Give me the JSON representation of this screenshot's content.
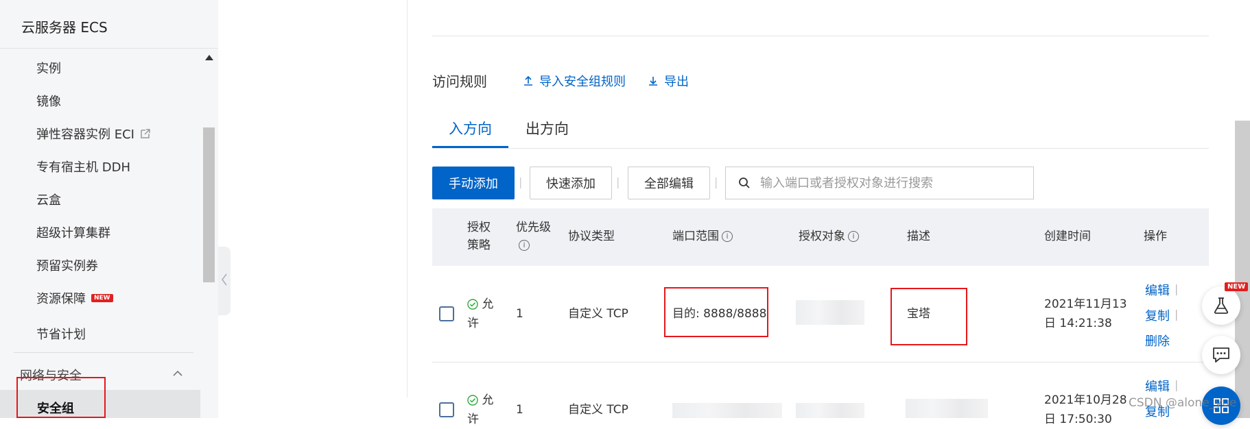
{
  "sidebar": {
    "title": "云服务器 ECS",
    "items": [
      {
        "label": "实例"
      },
      {
        "label": "镜像"
      },
      {
        "label": "弹性容器实例 ECI"
      },
      {
        "label": "专有宿主机 DDH"
      },
      {
        "label": "云盒"
      },
      {
        "label": "超级计算集群"
      },
      {
        "label": "预留实例券"
      },
      {
        "label": "资源保障",
        "badge": "NEW"
      },
      {
        "label": "节省计划"
      }
    ],
    "section": "网络与安全",
    "active_item": "安全组"
  },
  "rules": {
    "title": "访问规则",
    "import_label": "导入安全组规则",
    "export_label": "导出"
  },
  "tabs": {
    "inbound": "入方向",
    "outbound": "出方向"
  },
  "toolbar": {
    "manual_add": "手动添加",
    "quick_add": "快速添加",
    "edit_all": "全部编辑",
    "separator": "|",
    "search_placeholder": "输入端口或者授权对象进行搜索"
  },
  "table": {
    "columns": {
      "policy_line1": "授权",
      "policy_line2": "策略",
      "priority": "优先级",
      "protocol": "协议类型",
      "port_range": "端口范围",
      "auth_object": "授权对象",
      "description": "描述",
      "created": "创建时间",
      "actions": "操作"
    },
    "rows": [
      {
        "policy_line1": "允",
        "policy_line2": "许",
        "priority": "1",
        "protocol": "自定义 TCP",
        "port_range": "目的: 8888/8888",
        "description": "宝塔",
        "created_line1": "2021年11月13",
        "created_line2": "日 14:21:38",
        "actions": [
          "编辑",
          "复制",
          "删除"
        ]
      },
      {
        "policy_line1": "允",
        "policy_line2": "许",
        "priority": "1",
        "protocol": "自定义 TCP",
        "created_line1": "2021年10月28",
        "created_line2": "日 17:50:30",
        "actions": [
          "编辑",
          "复制"
        ]
      }
    ]
  },
  "float_tools": {
    "beta_badge": "NEW"
  },
  "watermark": "CSDN @alone_yue",
  "colors": {
    "accent": "#0064c8",
    "highlight_red": "#e6161a",
    "success_green": "#2fa83a"
  }
}
